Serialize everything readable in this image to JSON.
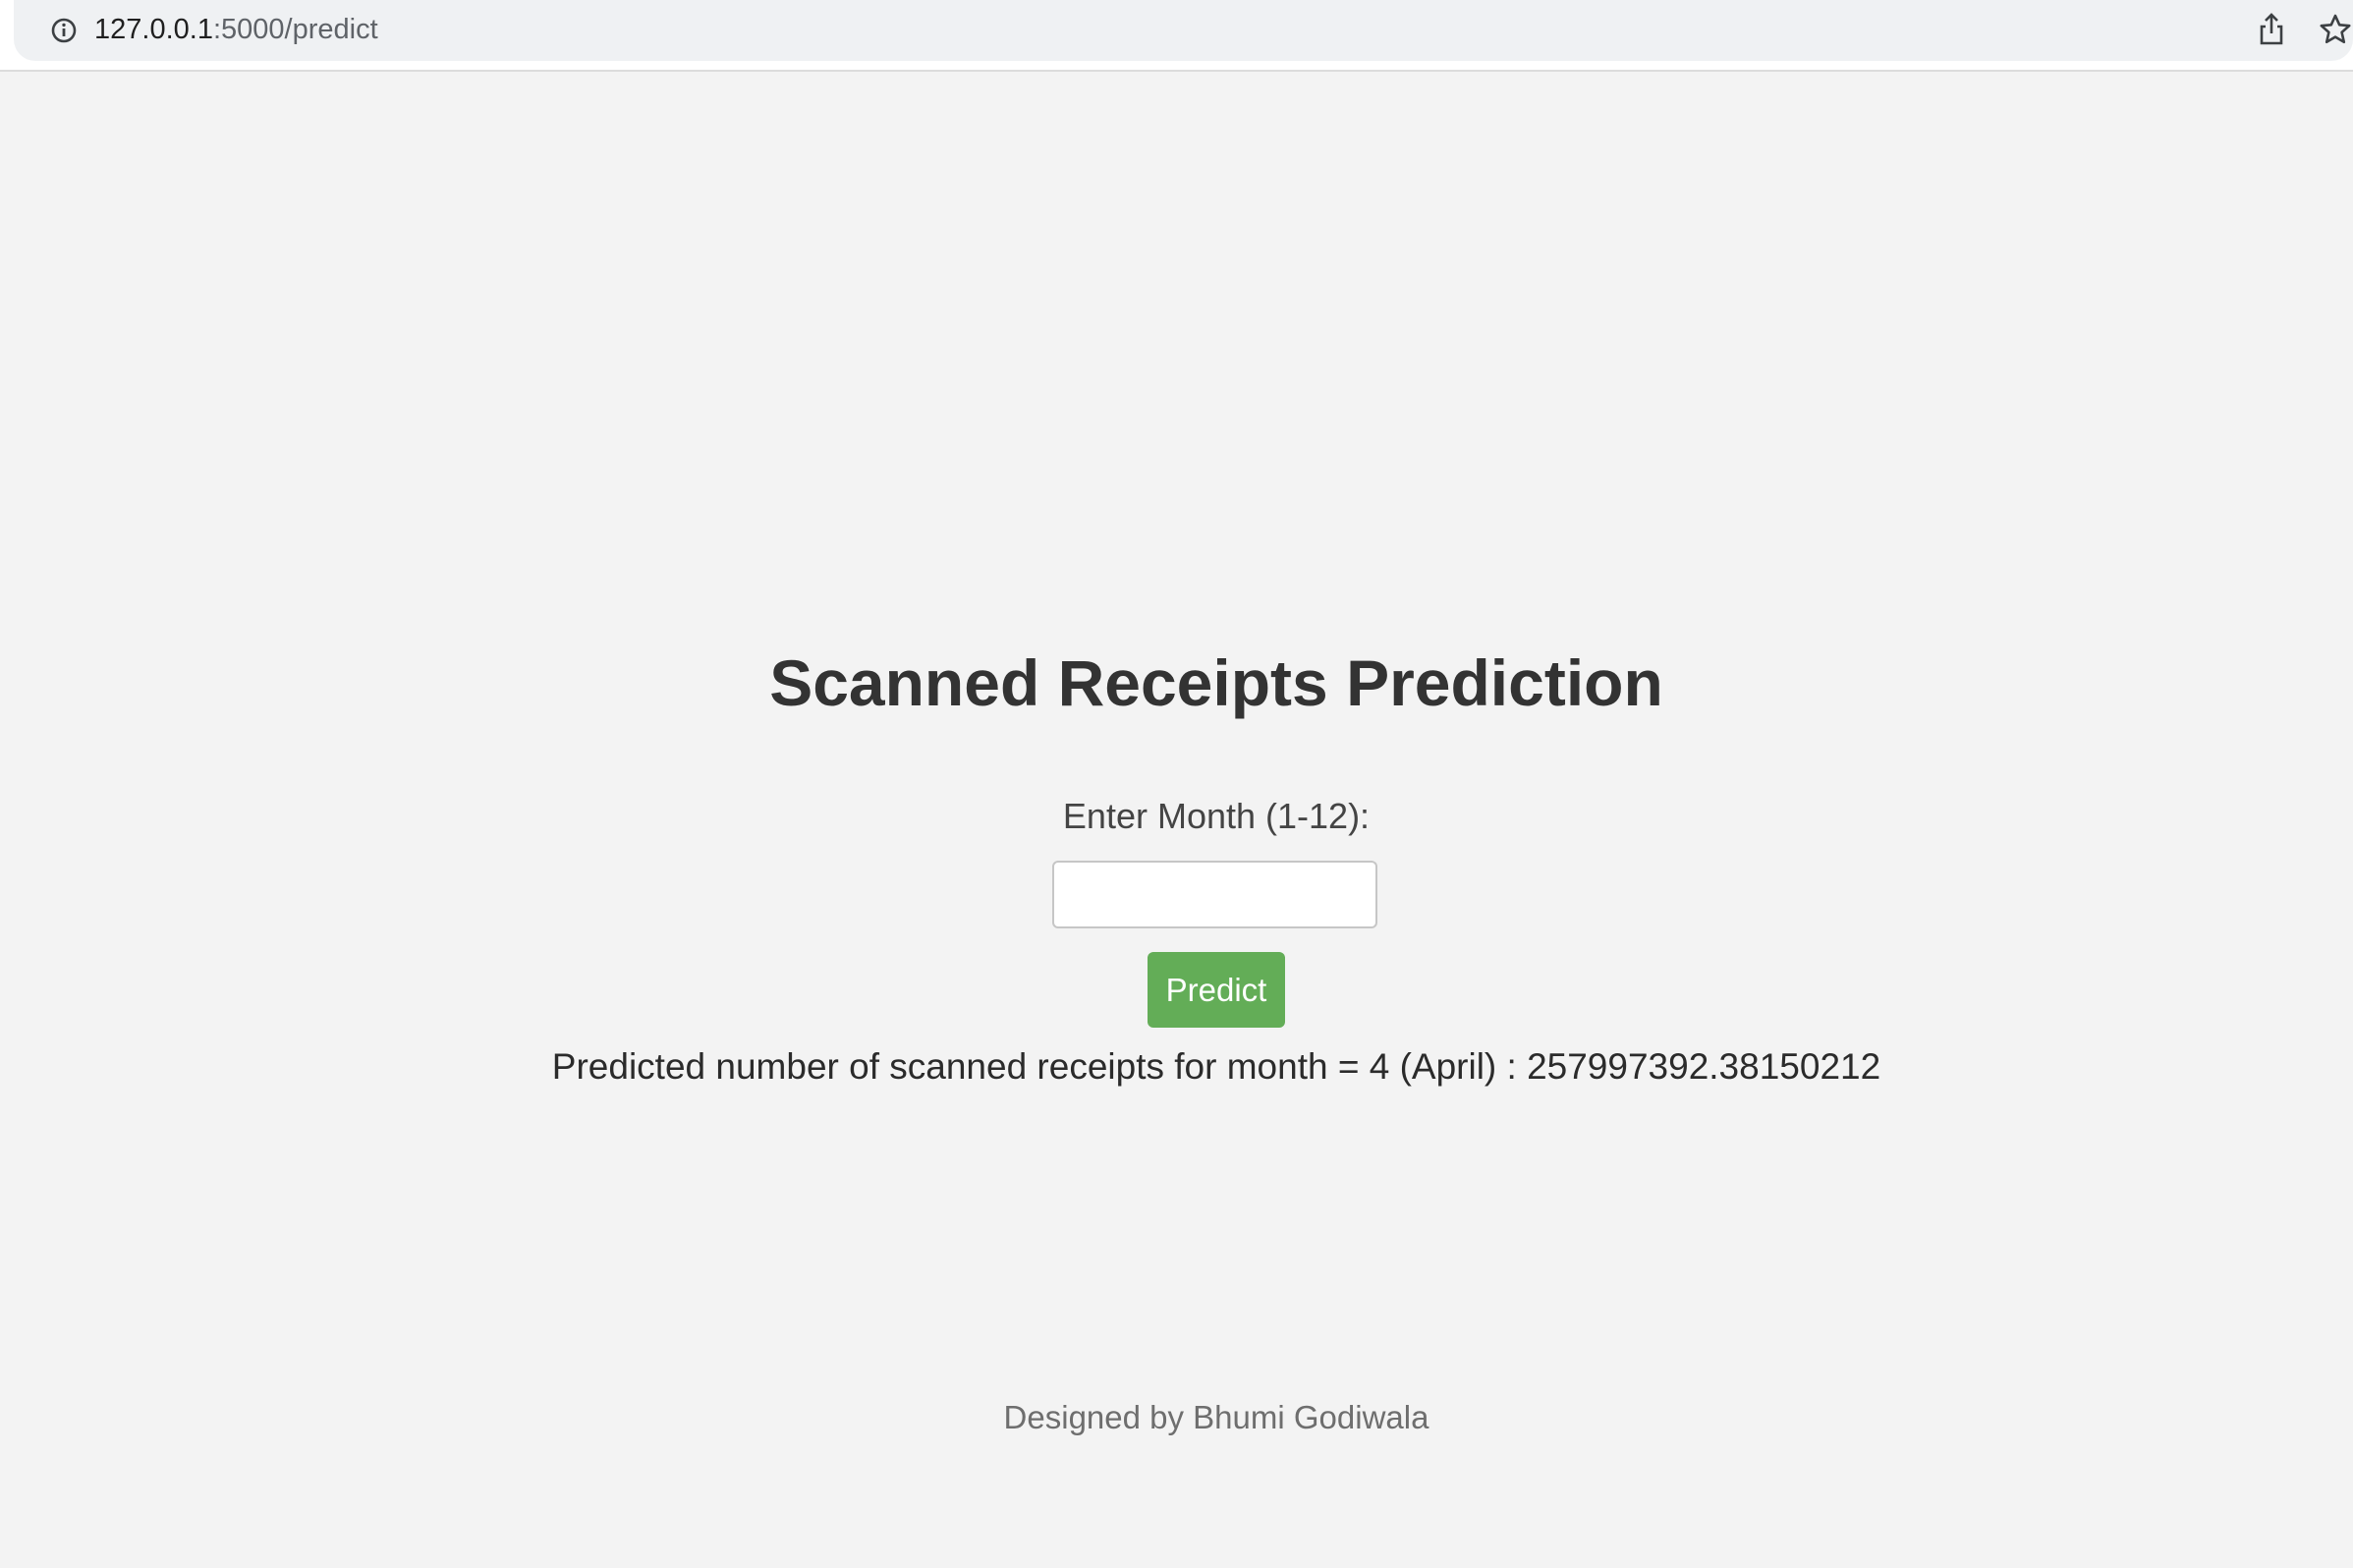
{
  "browser": {
    "url_host": "127.0.0.1",
    "url_path": ":5000/predict",
    "icons": [
      "info-icon",
      "share-icon",
      "star-icon"
    ]
  },
  "page": {
    "title": "Scanned Receipts Prediction",
    "month_label": "Enter Month (1-12):",
    "month_input_value": "",
    "predict_button_label": "Predict",
    "result_text": "Predicted number of scanned receipts for month = 4 (April) : 257997392.38150212",
    "footer_text": "Designed by Bhumi Godiwala"
  },
  "colors": {
    "background": "#f3f3f3",
    "button": "#63ad57",
    "title": "#333333"
  }
}
